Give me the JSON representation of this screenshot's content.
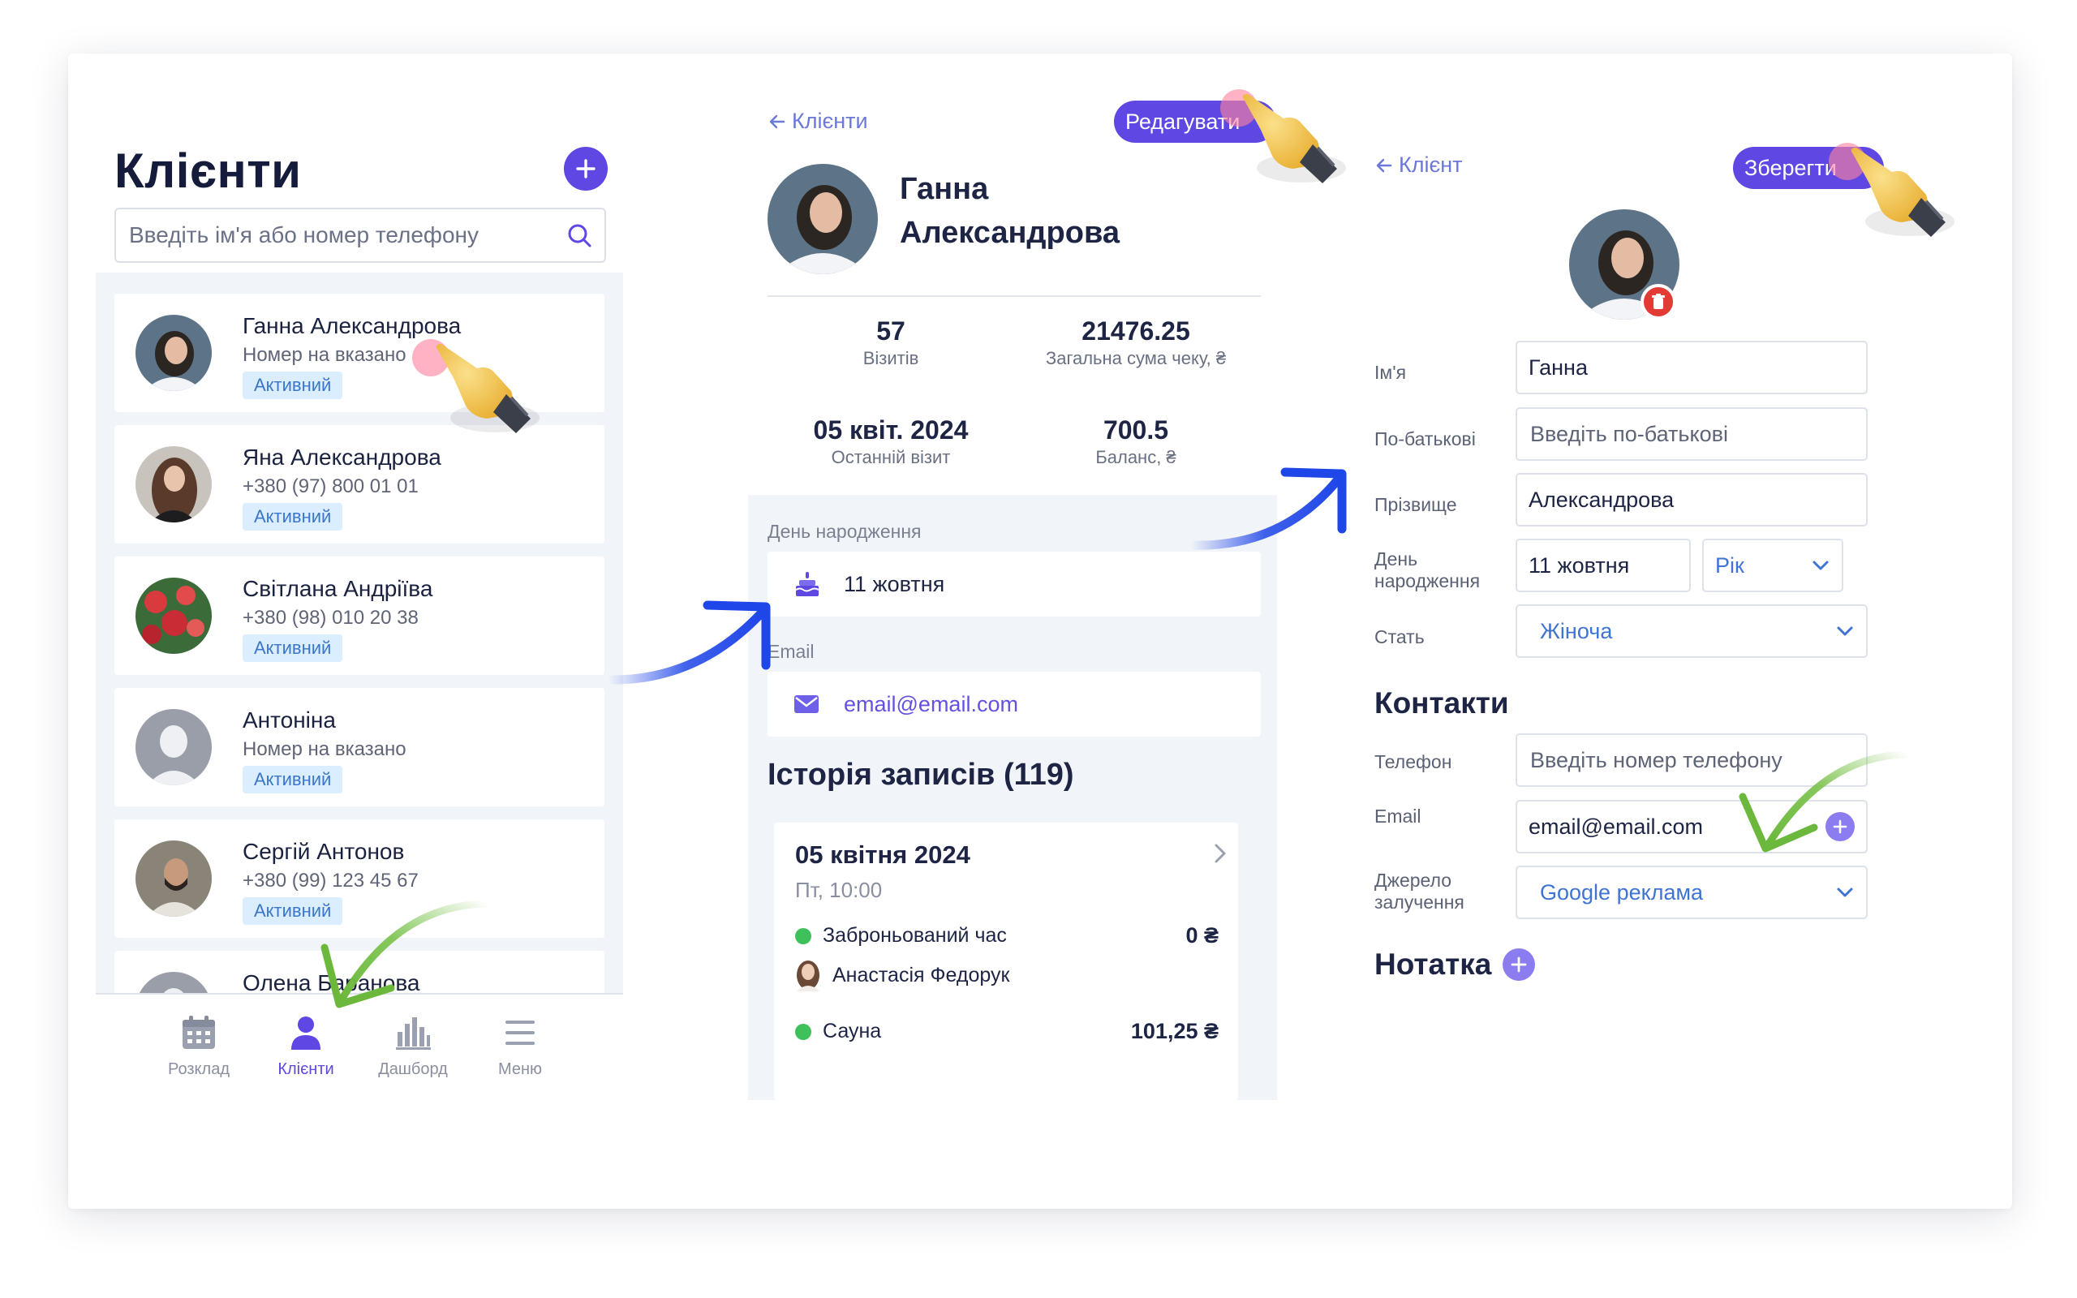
{
  "colors": {
    "accent": "#5e47e3",
    "link": "#6b78d8",
    "status_bg": "#dbeeff",
    "status_text": "#3b76c9",
    "success": "#3ec15a",
    "arrow_blue": "#1f46e8",
    "arrow_green": "#79c24a",
    "danger": "#e23b36"
  },
  "list_screen": {
    "title": "Клієнти",
    "search_placeholder": "Введіть ім'я або номер телефону",
    "clients": [
      {
        "name": "Ганна  Александрова",
        "phone": "Номер на вказано",
        "status": "Активний",
        "avatar": "woman-photo"
      },
      {
        "name": "Яна  Александрова",
        "phone": "+380 (97) 800 01 01",
        "status": "Активний",
        "avatar": "woman-photo"
      },
      {
        "name": "Світлана  Андріїва",
        "phone": "+380 (98) 010 20 38",
        "status": "Активний",
        "avatar": "flowers-photo"
      },
      {
        "name": "Антоніна",
        "phone": "Номер на вказано",
        "status": "Активний",
        "avatar": "placeholder-avatar"
      },
      {
        "name": "Сергій  Антонов",
        "phone": "+380 (99) 123 45 67",
        "status": "Активний",
        "avatar": "man-photo"
      },
      {
        "name": "Олена  Баранова",
        "phone": "",
        "status": "",
        "avatar": "placeholder-avatar"
      }
    ],
    "nav": [
      {
        "label": "Розклад",
        "icon": "calendar-icon"
      },
      {
        "label": "Клієнти",
        "icon": "user-icon"
      },
      {
        "label": "Дашборд",
        "icon": "bar-chart-icon"
      },
      {
        "label": "Меню",
        "icon": "menu-icon"
      }
    ]
  },
  "profile_screen": {
    "back_label": "Клієнти",
    "edit_label": "Редагувати",
    "first_name": "Ганна",
    "last_name": "Александрова",
    "stats": [
      {
        "value": "57",
        "label": "Візитів"
      },
      {
        "value": "21476.25",
        "label": "Загальна сума чеку, ₴"
      },
      {
        "value": "05 квіт. 2024",
        "label": "Останній візит"
      },
      {
        "value": "700.5",
        "label": "Баланс, ₴"
      }
    ],
    "birthday_label": "День народження",
    "birthday_value": "11 жовтня",
    "email_label": "Email",
    "email_value": "email@email.com",
    "history_title": "Історія записів (119)",
    "history": {
      "date": "05 квітня 2024",
      "time": "Пт, 10:00",
      "items": [
        {
          "name": "Заброньований час",
          "price": "0 ₴"
        },
        {
          "name": "Сауна",
          "price": "101,25 ₴"
        }
      ],
      "staff": "Анастасія Федорук"
    }
  },
  "edit_screen": {
    "back_label": "Клієнт",
    "save_label": "Зберегти",
    "fields": {
      "first_name_label": "Ім'я",
      "first_name_value": "Ганна",
      "patronymic_label": "По-батькові",
      "patronymic_placeholder": "Введіть по-батькові",
      "last_name_label": "Прізвище",
      "last_name_value": "Александрова",
      "birthday_label": "День народження",
      "birthday_value": "11 жовтня",
      "year_placeholder": "Рік",
      "gender_label": "Стать",
      "gender_value": "Жіноча"
    },
    "contacts": {
      "title": "Контакти",
      "phone_label": "Телефон",
      "phone_placeholder": "Введіть номер телефону",
      "email_label": "Email",
      "email_value": "email@email.com",
      "source_label": "Джерело залучення",
      "source_value": "Google реклама"
    },
    "note_title": "Нотатка"
  }
}
